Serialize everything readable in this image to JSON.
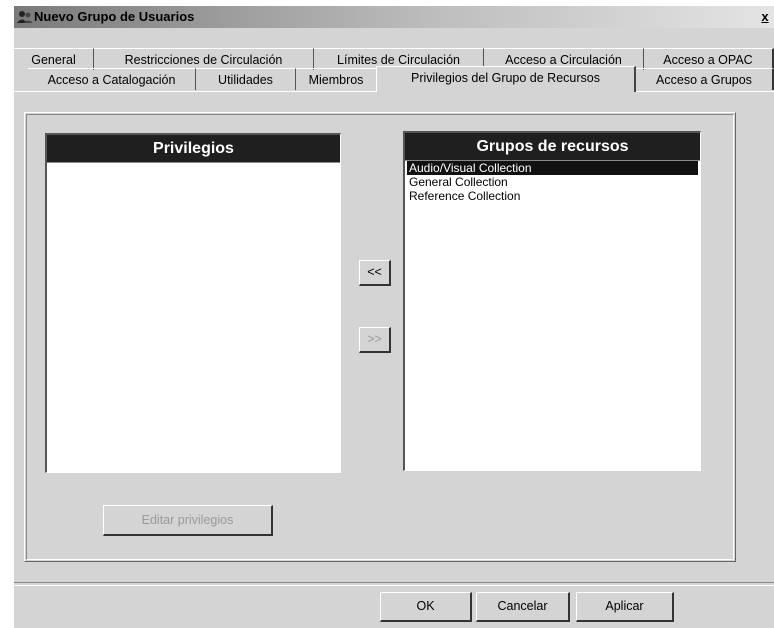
{
  "window": {
    "title": "Nuevo Grupo de Usuarios",
    "close_label": "x"
  },
  "tabs_row1": [
    {
      "label": "General"
    },
    {
      "label": "Restricciones de Circulación"
    },
    {
      "label": "Límites de Circulación"
    },
    {
      "label": "Acceso a Circulación"
    },
    {
      "label": "Acceso a OPAC"
    }
  ],
  "tabs_row2": [
    {
      "label": "Acceso a Catalogación"
    },
    {
      "label": "Utilidades"
    },
    {
      "label": "Miembros"
    },
    {
      "label": "Privilegios del Grupo de Recursos"
    },
    {
      "label": "Acceso a Grupos"
    }
  ],
  "active_tab": "Privilegios del Grupo de Recursos",
  "privileges": {
    "header": "Privilegios",
    "items": []
  },
  "groups": {
    "header": "Grupos de recursos",
    "items": [
      {
        "label": "Audio/Visual Collection",
        "selected": true
      },
      {
        "label": "General Collection",
        "selected": false
      },
      {
        "label": "Reference Collection",
        "selected": false
      }
    ]
  },
  "move_left_label": "<<",
  "move_right_label": ">>",
  "edit_privileges_label": "Editar privilegios",
  "footer": {
    "ok": "OK",
    "cancel": "Cancelar",
    "apply": "Aplicar"
  },
  "colors": {
    "selection_bg": "#111111",
    "header_bg": "#1f1f1f",
    "face": "#d4d4d4"
  }
}
